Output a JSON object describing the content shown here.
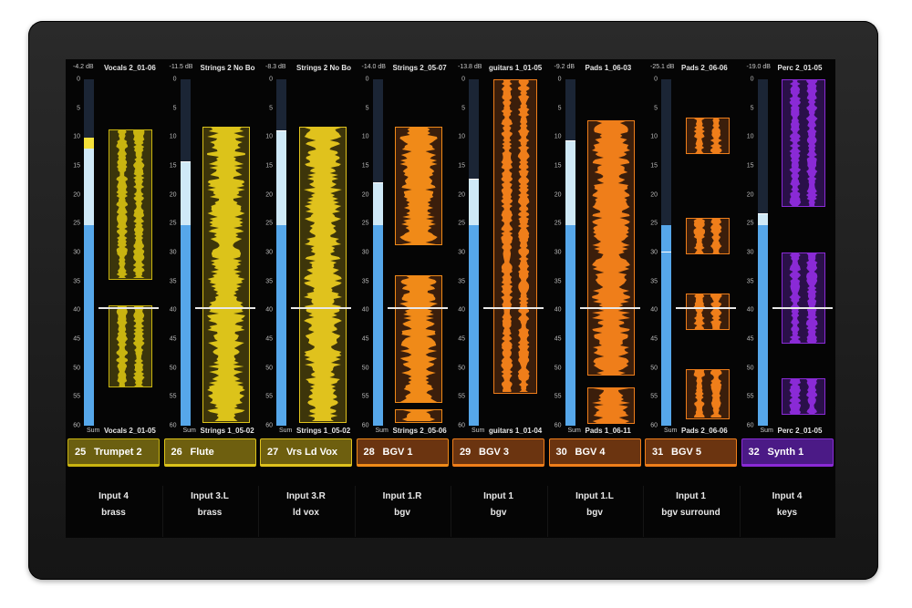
{
  "scale_ticks": [
    "0",
    "5",
    "10",
    "15",
    "20",
    "25",
    "30",
    "35",
    "40",
    "45",
    "50",
    "55",
    "60"
  ],
  "sum_label": "Sum",
  "channels": [
    {
      "number": "25",
      "name": "Trumpet 2",
      "level_db": "-4.2 dB",
      "clip_top": "Vocals 2_01-06",
      "clip_bottom": "Vocals 2_01-05",
      "input": "Input 4",
      "group": "brass",
      "color": "#c9b410",
      "bar_bg": "#6b5f10",
      "meter_level": 0.8
    },
    {
      "number": "26",
      "name": "Flute",
      "level_db": "-11.5 dB",
      "clip_top": "Strings 2 No Bo",
      "clip_bottom": "Strings 1_05-02",
      "input": "Input 3.L",
      "group": "brass",
      "color": "#dcc31a",
      "bar_bg": "#6e5f0f",
      "meter_level": 0.76
    },
    {
      "number": "27",
      "name": "Vrs Ld Vox",
      "level_db": "-8.3 dB",
      "clip_top": "Strings 2 No Bo",
      "clip_bottom": "Strings 1_05-02",
      "input": "Input 3.R",
      "group": "ld vox",
      "color": "#e0c21d",
      "bar_bg": "#6e5f0f",
      "meter_level": 0.85
    },
    {
      "number": "28",
      "name": "BGV 1",
      "level_db": "-14.0 dB",
      "clip_top": "Strings 2_05-07",
      "clip_bottom": "Strings 2_05-06",
      "input": "Input 1.R",
      "group": "bgv",
      "color": "#f08a18",
      "bar_bg": "#6b3410",
      "meter_level": 0.7
    },
    {
      "number": "29",
      "name": "BGV 3",
      "level_db": "-13.8 dB",
      "clip_top": "guitars 1_01-05",
      "clip_bottom": "guitars 1_01-04",
      "input": "Input 1",
      "group": "bgv",
      "color": "#ef7e1a",
      "bar_bg": "#6b3410",
      "meter_level": 0.71
    },
    {
      "number": "30",
      "name": "BGV 4",
      "level_db": "-9.2 dB",
      "clip_top": "Pads 1_06-03",
      "clip_bottom": "Pads 1_06-11",
      "input": "Input 1.L",
      "group": "bgv",
      "color": "#ef7e1a",
      "bar_bg": "#6b3410",
      "meter_level": 0.82
    },
    {
      "number": "31",
      "name": "BGV 5",
      "level_db": "-25.1 dB",
      "clip_top": "Pads 2_06-06",
      "clip_bottom": "Pads 2_06-06",
      "input": "Input 1",
      "group": "bgv surround",
      "color": "#ef7e1a",
      "bar_bg": "#6b3410",
      "meter_level": 0.5
    },
    {
      "number": "32",
      "name": "Synth 1",
      "level_db": "-19.0 dB",
      "clip_top": "Perc 2_01-05",
      "clip_bottom": "Perc 2_01-05",
      "input": "Input 4",
      "group": "keys",
      "color": "#8a2ad6",
      "bar_bg": "#4b1a86",
      "meter_level": 0.61
    }
  ]
}
